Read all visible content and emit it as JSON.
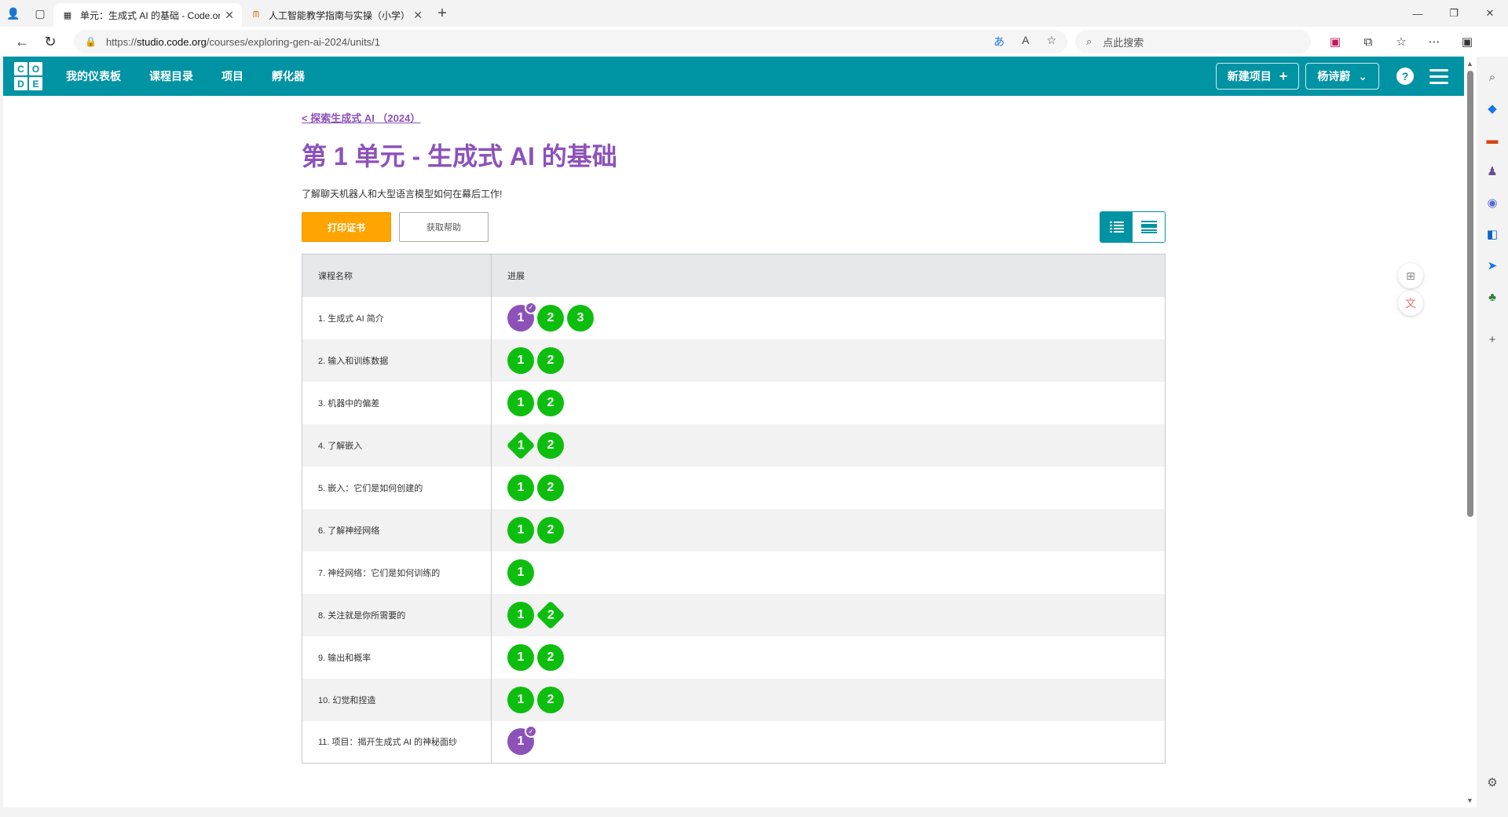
{
  "browser": {
    "tabs": [
      {
        "title": "单元：生成式 AI 的基础 - Code.org",
        "active": true,
        "favicon": "code-org-icon"
      },
      {
        "title": "人工智能教学指南与实操（小学）",
        "active": false,
        "favicon": "doc-icon"
      }
    ],
    "url_prefix": "https://",
    "url_host": "studio.code.org",
    "url_path": "/courses/exploring-gen-ai-2024/units/1",
    "search_placeholder": "点此搜索"
  },
  "site": {
    "logo_letters": [
      "C",
      "O",
      "D",
      "E"
    ],
    "nav": [
      "我的仪表板",
      "课程目录",
      "项目",
      "孵化器"
    ],
    "new_project": "新建项目",
    "user_name": "杨诗蔚",
    "help_symbol": "?",
    "brand_color": "#0093a4"
  },
  "unit": {
    "back_link": "< 探索生成式 AI （2024）",
    "title": "第 1 单元 - 生成式 AI 的基础",
    "description": "了解聊天机器人和大型语言模型如何在幕后工作!",
    "print_button": "打印证书",
    "help_button": "获取帮助",
    "accent_color": "#8c52ba"
  },
  "table": {
    "headers": [
      "课程名称",
      "进展"
    ],
    "rows": [
      {
        "name": "1. 生成式 AI 简介",
        "bubbles": [
          {
            "n": "1",
            "style": "purple-check"
          },
          {
            "n": "2",
            "style": "green"
          },
          {
            "n": "3",
            "style": "green"
          }
        ]
      },
      {
        "name": "2. 输入和训练数据",
        "bubbles": [
          {
            "n": "1",
            "style": "green"
          },
          {
            "n": "2",
            "style": "green"
          }
        ]
      },
      {
        "name": "3. 机器中的偏差",
        "bubbles": [
          {
            "n": "1",
            "style": "green"
          },
          {
            "n": "2",
            "style": "green"
          }
        ]
      },
      {
        "name": "4. 了解嵌入",
        "bubbles": [
          {
            "n": "1",
            "style": "diamond"
          },
          {
            "n": "2",
            "style": "green"
          }
        ]
      },
      {
        "name": "5. 嵌入：它们是如何创建的",
        "bubbles": [
          {
            "n": "1",
            "style": "green"
          },
          {
            "n": "2",
            "style": "green"
          }
        ]
      },
      {
        "name": "6. 了解神经网络",
        "bubbles": [
          {
            "n": "1",
            "style": "green"
          },
          {
            "n": "2",
            "style": "green"
          }
        ]
      },
      {
        "name": "7. 神经网络：它们是如何训练的",
        "bubbles": [
          {
            "n": "1",
            "style": "green"
          }
        ]
      },
      {
        "name": "8. 关注就是你所需要的",
        "bubbles": [
          {
            "n": "1",
            "style": "green"
          },
          {
            "n": "2",
            "style": "diamond"
          }
        ]
      },
      {
        "name": "9. 输出和概率",
        "bubbles": [
          {
            "n": "1",
            "style": "green"
          },
          {
            "n": "2",
            "style": "green"
          }
        ]
      },
      {
        "name": "10. 幻觉和捏造",
        "bubbles": [
          {
            "n": "1",
            "style": "green"
          },
          {
            "n": "2",
            "style": "green"
          }
        ]
      },
      {
        "name": "11. 项目：揭开生成式 AI 的神秘面纱",
        "bubbles": [
          {
            "n": "1",
            "style": "purple-check"
          }
        ]
      }
    ]
  }
}
